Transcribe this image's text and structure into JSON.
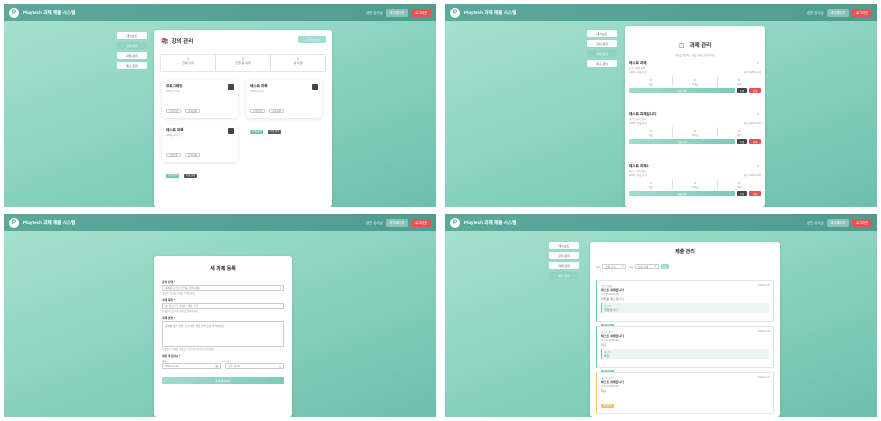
{
  "header": {
    "app_title": "Playtech 과제 제출 시스템",
    "user": "김민 강사님",
    "btn_mypage": "마이페이지",
    "btn_logout": "로그아웃"
  },
  "sidebar": [
    "대시보드",
    "강의 관리",
    "과제 관리",
    "제출 관리"
  ],
  "panel1": {
    "title": "강의 관리",
    "new_button": "+ 새 강의 생성",
    "stats": [
      {
        "value": "3",
        "label": "전체 강의"
      },
      {
        "value": "0",
        "label": "진행 중 과제"
      },
      {
        "value": "0",
        "label": "총 학생"
      }
    ],
    "courses": [
      {
        "name": "프로그래밍",
        "sub": "2025년 2학기",
        "tag1": "수강인원",
        "tag2": "과제현황",
        "b1": "과제 관리",
        "b2": "학생 관리"
      },
      {
        "name": "테스트 과목",
        "sub": "2025년 2학기",
        "tag1": "수강인원",
        "tag2": "과제현황",
        "b1": "과제 관리",
        "b2": "학생 관리"
      },
      {
        "name": "테스트 과목",
        "sub": "2025년 2학기",
        "tag1": "수강인원",
        "tag2": "과제현황",
        "b1": "과제 관리",
        "b2": "학생 관리"
      }
    ]
  },
  "panel2": {
    "title": "과제 관리",
    "subtitle": "과제를 생성하고 제출 현황을 확인하세요",
    "items": [
      {
        "name": "테스트 과제",
        "course": "프로그래밍 강의",
        "meta": "2025년 제출 마감",
        "due": "마감 2025-11-04",
        "s": [
          "0",
          "0",
          "0"
        ],
        "sl": [
          "제출",
          "미제출",
          "채점"
        ],
        "view": "제출 현황",
        "edit": "수정",
        "del": "삭제"
      },
      {
        "name": "테스트 과제입니다",
        "course": "테스트 과목 강의",
        "meta": "2025년 제출 마감",
        "due": "마감 2025-10-28",
        "s": [
          "0",
          "0",
          "0"
        ],
        "sl": [
          "제출",
          "미제출",
          "채점"
        ],
        "view": "제출 현황",
        "edit": "수정",
        "del": "삭제"
      },
      {
        "name": "테스트 과제3",
        "course": "테스트 과목 강의",
        "meta": "2025년 제출 마감",
        "due": "마감 2025-10-28",
        "s": [
          "0",
          "0",
          "0"
        ],
        "sl": [
          "제출",
          "미제출",
          "채점"
        ],
        "view": "제출 현황",
        "edit": "수정",
        "del": "삭제"
      }
    ]
  },
  "panel3": {
    "title": "새 과제 등록",
    "course_label": "강의 선택 *",
    "course_value": "과제를 등록할 강의를 선택하세요",
    "course_hint": "과제가 게시될 강의를 선택하세요",
    "title_label": "과제 제목 *",
    "title_placeholder": "예: 자료구조 과제1 - 배열 구현",
    "title_hint": "학생들이 볼 과제 제목을 입력하세요",
    "desc_label": "과제 설명 *",
    "desc_placeholder": "과제에 대한 설명, 요구사항, 제출 형식 등을 입력하세요",
    "desc_hint": "학생들이 과제를 이해할 수 있도록 자세히 작성하세요",
    "due_label": "제출 마감일시 *",
    "date_label": "날짜",
    "time_label": "시간",
    "date_value": "2025-10-24",
    "time_value": "오후 11:59",
    "submit": "과제 등록하기"
  },
  "panel4": {
    "title": "제출 관리",
    "filter_course_label": "강의",
    "filter_course_value": "전체 강의",
    "filter_task_label": "과제",
    "filter_task_value": "전체 과제",
    "filter_button": "조회",
    "subs": [
      {
        "course": "프로그래밍",
        "name": "테스트 과제입니다",
        "who": "김학생 (2025123)",
        "date": "2025-10-22",
        "body": "과제를 제출합니다.",
        "fb_label": "피드백",
        "fb": "잘했습니다",
        "status": "채점완료",
        "kind": "teal"
      },
      {
        "course": "테스트 과목",
        "name": "테스트 과제입니다",
        "who": "이학생 (2025124)",
        "date": "2025-10-22",
        "body": "제출",
        "fb_label": "피드백",
        "fb": "확인",
        "status": "채점완료",
        "kind": "teal"
      },
      {
        "course": "테스트 과목",
        "name": "테스트 과제입니다",
        "who": "박학생 (2025125)",
        "date": "2025-10-21",
        "body": "제출",
        "fb_label": "",
        "fb": "",
        "status": "채점대기",
        "kind": "y"
      }
    ]
  }
}
